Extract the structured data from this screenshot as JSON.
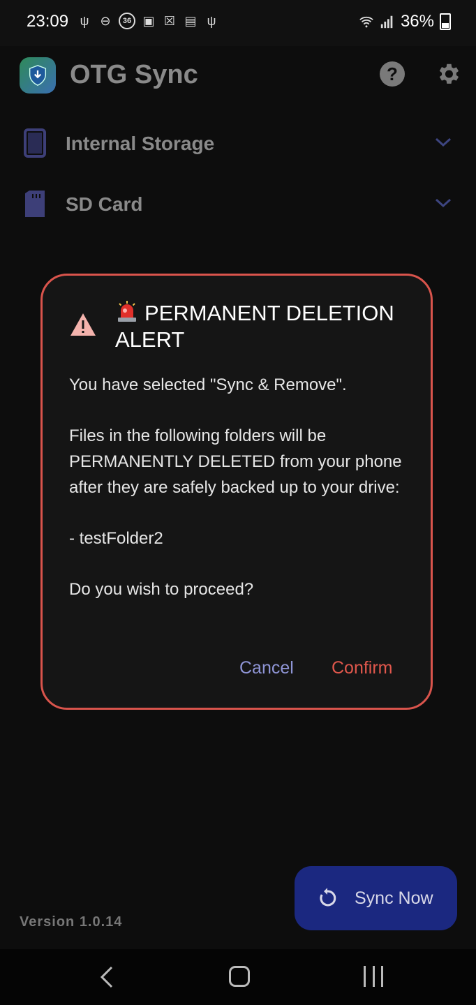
{
  "status_bar": {
    "time": "23:09",
    "battery": "36%",
    "left_icons": [
      "usb-icon",
      "dnd-icon",
      "counter-36-icon",
      "image-icon",
      "sim-icon",
      "calendar-icon",
      "usb-icon"
    ],
    "badge_number": "36"
  },
  "app": {
    "title": "OTG Sync",
    "storage_items": [
      {
        "label": "Internal Storage",
        "icon": "phone-icon"
      },
      {
        "label": "SD Card",
        "icon": "sd-card-icon"
      }
    ],
    "version": "Version 1.0.14",
    "sync_button_label": "Sync Now"
  },
  "dialog": {
    "title": "PERMANENT DELETION ALERT",
    "line1": "You have selected \"Sync & Remove\".",
    "line2": "Files in the following folders will be PERMANENTLY DELETED from your phone after they are safely backed up to your drive:",
    "folder": "- testFolder2",
    "question": "Do you wish to proceed?",
    "cancel_label": "Cancel",
    "confirm_label": "Confirm"
  },
  "colors": {
    "dialog_border": "#d9544c",
    "confirm": "#e0574c",
    "cancel": "#8f95d6",
    "sync_button": "#1b2880"
  }
}
